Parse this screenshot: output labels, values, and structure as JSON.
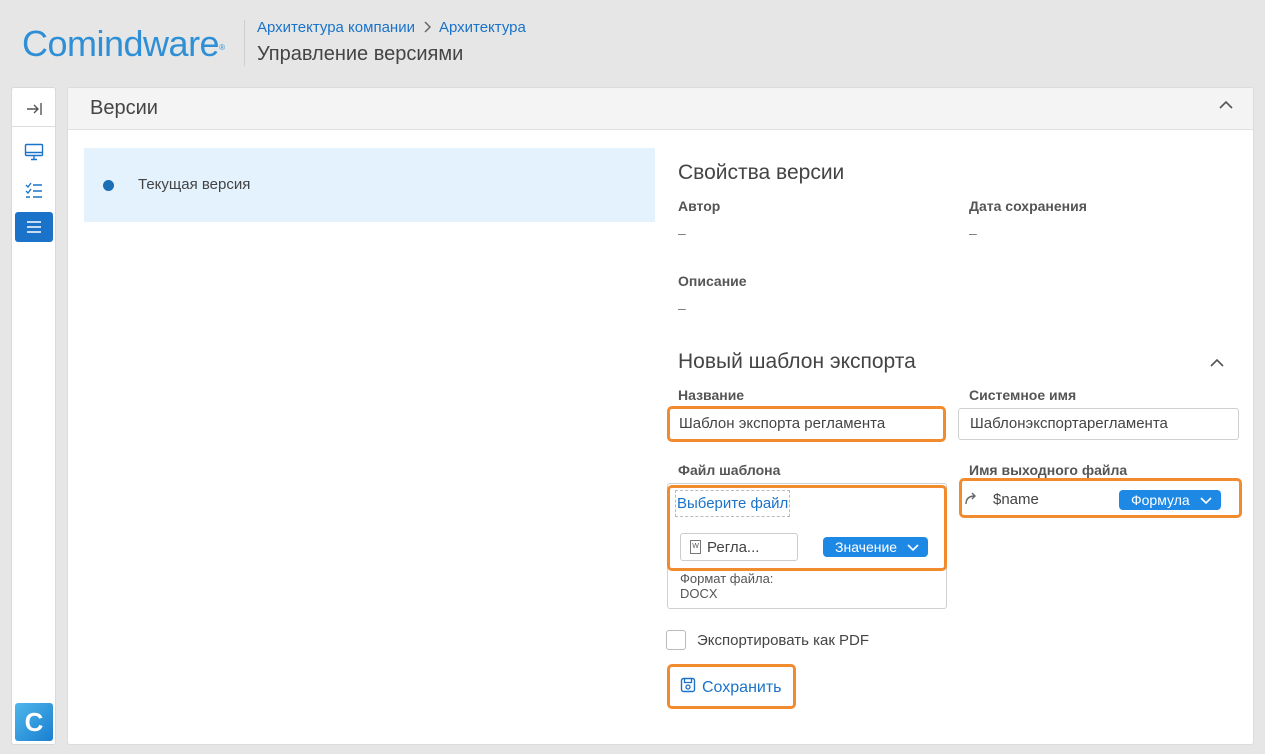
{
  "header": {
    "logo_text": "Comindware",
    "logo_mark": "®",
    "breadcrumb": [
      "Архитектура компании",
      "Архитектура"
    ],
    "breadcrumb_sep": ">",
    "page_title": "Управление версиями"
  },
  "rail": {
    "icons": [
      "collapse-sidebar-icon",
      "desktop-icon",
      "checklist-icon",
      "list-icon"
    ],
    "logo_letter": "C"
  },
  "panel": {
    "title": "Версии",
    "versions": [
      {
        "label": "Текущая версия"
      }
    ]
  },
  "version_props": {
    "title": "Свойства версии",
    "author_label": "Автор",
    "author_value": "–",
    "saved_date_label": "Дата сохранения",
    "saved_date_value": "–",
    "description_label": "Описание",
    "description_value": "–"
  },
  "export_template": {
    "title": "Новый шаблон экспорта",
    "name_label": "Название",
    "name_value": "Шаблон экспорта регламента",
    "system_name_label": "Системное имя",
    "system_name_value": "Шаблонэкспортарегламента",
    "file_label": "Файл шаблона",
    "choose_file": "Выберите файл",
    "file_name": "Регла...",
    "file_mode": "Значение",
    "format_label": "Формат файла:",
    "format_value": "DOCX",
    "output_label": "Имя выходного файла",
    "output_value": "$name",
    "output_mode": "Формула",
    "export_pdf_label": "Экспортировать как PDF",
    "export_pdf_checked": false,
    "save_label": "Сохранить"
  },
  "colors": {
    "accent": "#1a73c9",
    "highlight": "#f28a2e",
    "selected_bg": "#e3f2fd"
  }
}
